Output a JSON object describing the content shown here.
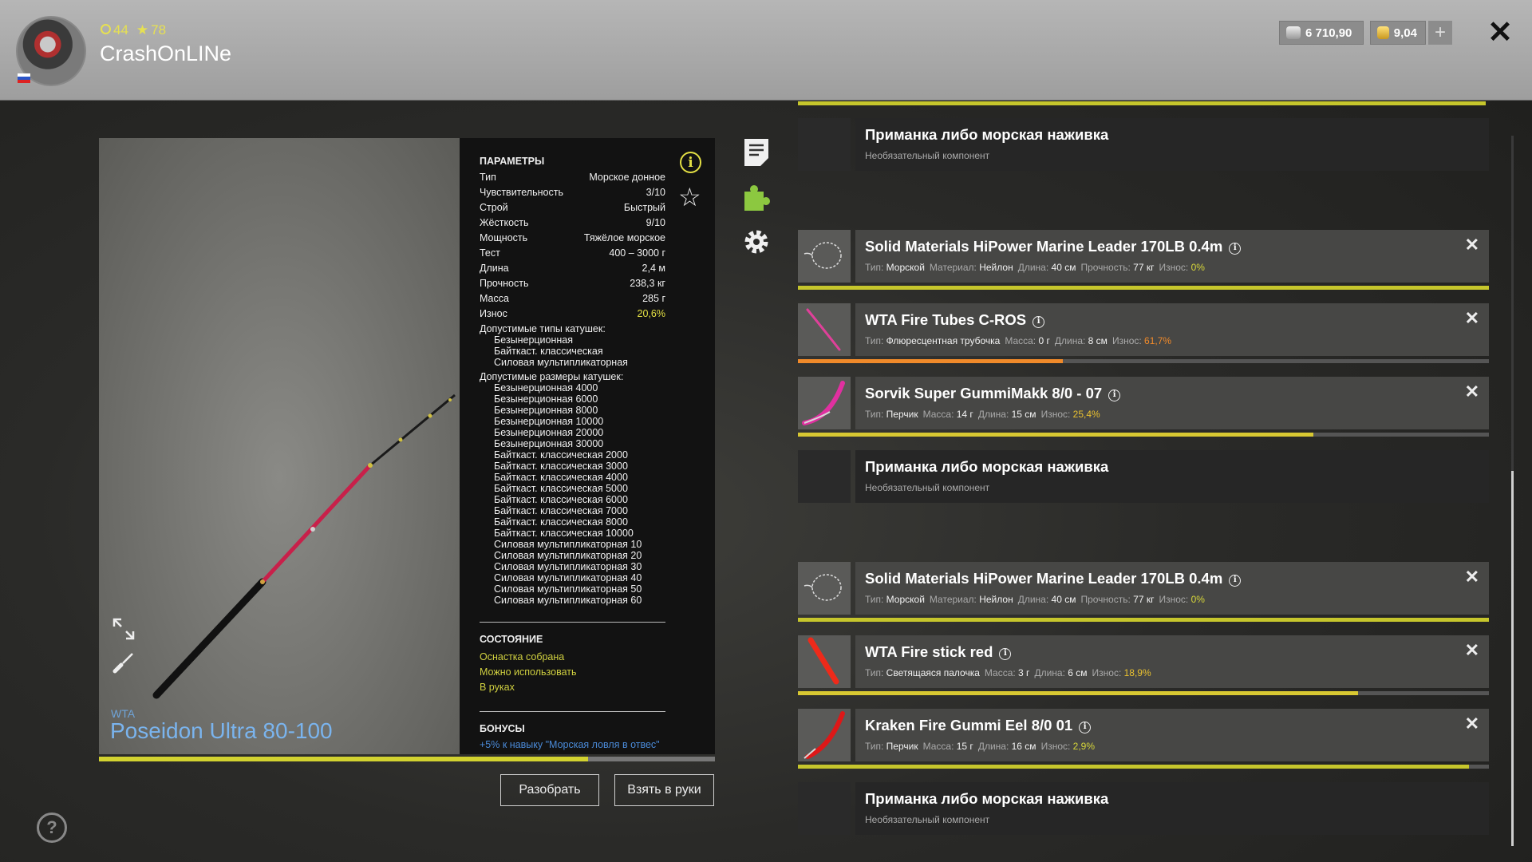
{
  "player": {
    "name": "CrashOnLINe",
    "level": "44",
    "rank": "78",
    "country": "Russia"
  },
  "currency": {
    "silver": "6 710,90",
    "gold": "9,04"
  },
  "rod": {
    "brand": "WTA",
    "name": "Poseidon Ultra 80-100",
    "condition_percent": 79.4
  },
  "params": {
    "title": "ПАРАМЕТРЫ",
    "rows": [
      {
        "label": "Тип",
        "value": "Морское донное"
      },
      {
        "label": "Чувствительность",
        "value": "3/10"
      },
      {
        "label": "Строй",
        "value": "Быстрый"
      },
      {
        "label": "Жёсткость",
        "value": "9/10"
      },
      {
        "label": "Мощность",
        "value": "Тяжёлое морское"
      },
      {
        "label": "Тест",
        "value": "400 – 3000 г"
      },
      {
        "label": "Длина",
        "value": "2,4 м"
      },
      {
        "label": "Прочность",
        "value": "238,3 кг"
      },
      {
        "label": "Масса",
        "value": "285 г"
      },
      {
        "label": "Износ",
        "value": "20,6%"
      }
    ],
    "reel_types_label": "Допустимые типы катушек:",
    "reel_types": [
      "Безынерционная",
      "Байткаст. классическая",
      "Силовая мультипликаторная"
    ],
    "reel_sizes_label": "Допустимые размеры катушек:",
    "reel_sizes": [
      "Безынерционная 4000",
      "Безынерционная 6000",
      "Безынерционная 8000",
      "Безынерционная 10000",
      "Безынерционная 20000",
      "Безынерционная 30000",
      "Байткаст. классическая 2000",
      "Байткаст. классическая 3000",
      "Байткаст. классическая 4000",
      "Байткаст. классическая 5000",
      "Байткаст. классическая 6000",
      "Байткаст. классическая 7000",
      "Байткаст. классическая 8000",
      "Байткаст. классическая 10000",
      "Силовая мультипликаторная 10",
      "Силовая мультипликаторная 20",
      "Силовая мультипликаторная 30",
      "Силовая мультипликаторная 40",
      "Силовая мультипликаторная 50",
      "Силовая мультипликаторная 60"
    ],
    "status_title": "СОСТОЯНИЕ",
    "status": [
      "Оснастка собрана",
      "Можно использовать",
      "В руках"
    ],
    "bonus_title": "БОНУСЫ",
    "bonus": "+5% к навыку \"Морская ловля в отвес\""
  },
  "buttons": {
    "disassemble": "Разобрать",
    "take": "Взять в руки"
  },
  "slots": [
    {
      "kind": "empty",
      "title": "Приманка либо морская наживка",
      "subtitle": "Необязательный компонент"
    },
    {
      "kind": "item",
      "title": "Solid Materials HiPower Marine Leader 170LB 0.4m",
      "specs": [
        {
          "k": "Тип:",
          "v": "Морской"
        },
        {
          "k": "Материал:",
          "v": "Нейлон"
        },
        {
          "k": "Длина:",
          "v": "40 см"
        },
        {
          "k": "Прочность:",
          "v": "77 кг"
        }
      ],
      "wear_label": "Износ:",
      "wear": "0%",
      "wear_percent": 0,
      "thumb": "leader-coil"
    },
    {
      "kind": "item",
      "title": "WTA Fire Tubes C-ROS",
      "specs": [
        {
          "k": "Тип:",
          "v": "Флюресцентная трубочка"
        },
        {
          "k": "Масса:",
          "v": "0 г"
        },
        {
          "k": "Длина:",
          "v": "8 см"
        }
      ],
      "wear_label": "Износ:",
      "wear": "61,7%",
      "wear_percent": 61.7,
      "thumb": "pink-tube"
    },
    {
      "kind": "item",
      "title": "Sorvik Super GummiMakk 8/0 - 07",
      "specs": [
        {
          "k": "Тип:",
          "v": "Перчик"
        },
        {
          "k": "Масса:",
          "v": "14 г"
        },
        {
          "k": "Длина:",
          "v": "15 см"
        }
      ],
      "wear_label": "Износ:",
      "wear": "25,4%",
      "wear_percent": 25.4,
      "thumb": "pink-lure"
    },
    {
      "kind": "empty",
      "title": "Приманка либо морская наживка",
      "subtitle": "Необязательный компонент"
    },
    {
      "kind": "item",
      "title": "Solid Materials HiPower Marine Leader 170LB 0.4m",
      "specs": [
        {
          "k": "Тип:",
          "v": "Морской"
        },
        {
          "k": "Материал:",
          "v": "Нейлон"
        },
        {
          "k": "Длина:",
          "v": "40 см"
        },
        {
          "k": "Прочность:",
          "v": "77 кг"
        }
      ],
      "wear_label": "Износ:",
      "wear": "0%",
      "wear_percent": 0,
      "thumb": "leader-coil"
    },
    {
      "kind": "item",
      "title": "WTA Fire stick red",
      "specs": [
        {
          "k": "Тип:",
          "v": "Светящаяся палочка"
        },
        {
          "k": "Масса:",
          "v": "3 г"
        },
        {
          "k": "Длина:",
          "v": "6 см"
        }
      ],
      "wear_label": "Износ:",
      "wear": "18,9%",
      "wear_percent": 18.9,
      "thumb": "red-stick"
    },
    {
      "kind": "item",
      "title": "Kraken Fire Gummi Eel 8/0 01",
      "specs": [
        {
          "k": "Тип:",
          "v": "Перчик"
        },
        {
          "k": "Масса:",
          "v": "15 г"
        },
        {
          "k": "Длина:",
          "v": "16 см"
        }
      ],
      "wear_label": "Износ:",
      "wear": "2,9%",
      "wear_percent": 2.9,
      "thumb": "red-eel"
    },
    {
      "kind": "empty",
      "title": "Приманка либо морская наживка",
      "subtitle": "Необязательный компонент"
    }
  ],
  "colors": {
    "accent_yellow": "#e4e044",
    "wear_orange": "#f08a2a",
    "name_blue": "#7ab4ee"
  }
}
